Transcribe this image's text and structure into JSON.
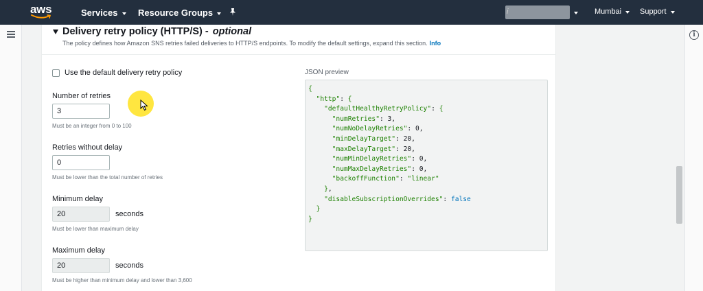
{
  "nav": {
    "logo": "aws",
    "services": "Services",
    "resource_groups": "Resource Groups",
    "region": "Mumbai",
    "support": "Support",
    "account_initial": "i"
  },
  "section": {
    "title": "Delivery retry policy (HTTP/S) -",
    "title_optional": "optional",
    "description": "The policy defines how Amazon SNS retries failed deliveries to HTTP/S endpoints. To modify the default settings, expand this section.",
    "info_link": "Info"
  },
  "checkbox": {
    "label": "Use the default delivery retry policy",
    "checked": false
  },
  "fields": {
    "num_retries": {
      "label": "Number of retries",
      "value": "3",
      "hint": "Must be an integer from 0 to 100"
    },
    "retries_without_delay": {
      "label": "Retries without delay",
      "value": "0",
      "hint": "Must be lower than the total number of retries"
    },
    "min_delay": {
      "label": "Minimum delay",
      "value": "20",
      "unit": "seconds",
      "hint": "Must be lower than maximum delay"
    },
    "max_delay": {
      "label": "Maximum delay",
      "value": "20",
      "unit": "seconds",
      "hint": "Must be higher than minimum delay and lower than 3,600"
    }
  },
  "json_preview": {
    "label": "JSON preview",
    "text": "{\n  \"http\": {\n    \"defaultHealthyRetryPolicy\": {\n      \"numRetries\": 3,\n      \"numNoDelayRetries\": 0,\n      \"minDelayTarget\": 20,\n      \"maxDelayTarget\": 20,\n      \"numMinDelayRetries\": 0,\n      \"numMaxDelayRetries\": 0,\n      \"backoffFunction\": \"linear\"\n    },\n    \"disableSubscriptionOverrides\": false\n  }\n}"
  },
  "icons": {
    "menu": "hamburger-icon",
    "info": "info-icon",
    "pin": "pin-icon",
    "cursor": "mouse-cursor"
  },
  "colors": {
    "nav_bg": "#232f3e",
    "link": "#0073bb",
    "json_key": "#1d8102",
    "json_string": "#1d8102",
    "json_brace": "#1d8102",
    "json_number": "#16191f",
    "json_bool": "#0073bb",
    "highlight": "#ffdd00"
  }
}
